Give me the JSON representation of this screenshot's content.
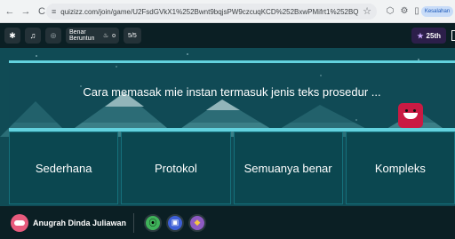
{
  "browser": {
    "url": "quizizz.com/join/game/U2FsdGVkX1%252Bwnt9bqjsPW9czcuqKCD%252BxwPMifrt1%252BQMnHonKA5UakXSKguHiNknVWAG%...",
    "profile_label": "Kesalahan"
  },
  "quiz_top": {
    "power_label": "Benar Beruntun",
    "power_count": "o",
    "question_counter": "5/5",
    "rank": "25th"
  },
  "question": {
    "text": "Cara memasak mie instan termasuk jenis teks prosedur ..."
  },
  "options": [
    {
      "label": "Sederhana"
    },
    {
      "label": "Protokol"
    },
    {
      "label": "Semuanya benar"
    },
    {
      "label": "Kompleks"
    }
  ],
  "player": {
    "name": "Anugrah Dinda Juliawan"
  },
  "colors": {
    "stage": "#104b55",
    "accent": "#63d2de",
    "bar": "#0b1f24"
  }
}
